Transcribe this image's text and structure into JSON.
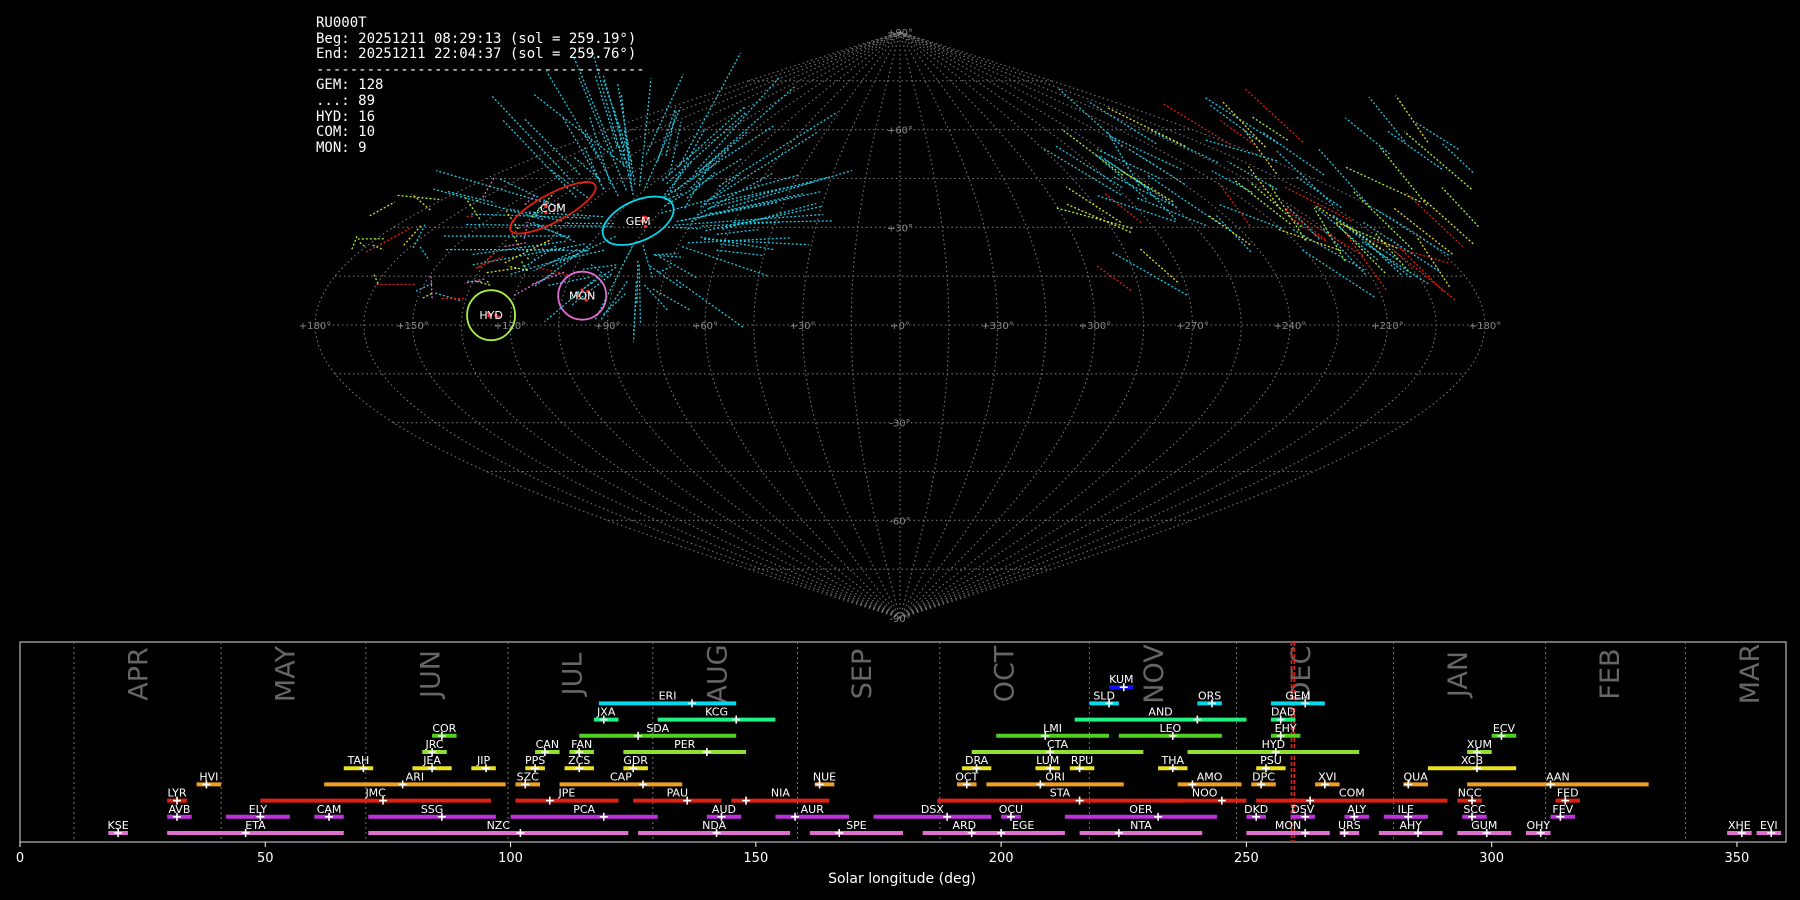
{
  "info": {
    "station": "RU000T",
    "beg": "Beg: 20251211 08:29:13 (sol = 259.19°)",
    "end": "End: 20251211 22:04:37 (sol = 259.76°)",
    "separator": "---------------------------------------",
    "counts": [
      "GEM: 128",
      "...: 89",
      "HYD: 16",
      "COM: 10",
      "MON: 9"
    ]
  },
  "sky_map": {
    "lon_labels": [
      "+180°",
      "+150°",
      "+120°",
      "+90°",
      "+60°",
      "+30°",
      "+0°",
      "+330°",
      "+300°",
      "+270°",
      "+240°",
      "+210°",
      "+180°"
    ],
    "lat_labels": [
      "+90°",
      "+60°",
      "+30°",
      "-30°",
      "-60°",
      "-90°"
    ],
    "radiants": [
      {
        "code": "COM",
        "lon": 132,
        "lat": 36,
        "color": "#e02010"
      },
      {
        "code": "GEM",
        "lon": 95,
        "lat": 32,
        "color": "#00d8ec"
      },
      {
        "code": "MON",
        "lon": 99,
        "lat": 9,
        "color": "#e070d0"
      },
      {
        "code": "HYD",
        "lon": 126,
        "lat": 3,
        "color": "#a8f040"
      }
    ]
  },
  "chart_data": {
    "type": "bar",
    "xlabel": "Solar longitude (deg)",
    "xlim": [
      0,
      360
    ],
    "x_ticks": [
      0,
      50,
      100,
      150,
      200,
      250,
      300,
      350
    ],
    "months": [
      {
        "name": "APR",
        "start": 11
      },
      {
        "name": "MAY",
        "start": 41
      },
      {
        "name": "JUN",
        "start": 70.5
      },
      {
        "name": "JUL",
        "start": 99.5
      },
      {
        "name": "AUG",
        "start": 129
      },
      {
        "name": "SEP",
        "start": 158.5
      },
      {
        "name": "OCT",
        "start": 187.5
      },
      {
        "name": "NOV",
        "start": 218
      },
      {
        "name": "DEC",
        "start": 248
      },
      {
        "name": "JAN",
        "start": 280
      },
      {
        "name": "FEB",
        "start": 311
      },
      {
        "name": "MAR",
        "start": 339.5
      }
    ],
    "current_sol": [
      259.19,
      259.76
    ],
    "showers": [
      {
        "code": "KUM",
        "start": 222,
        "end": 227,
        "peak": 225,
        "row": 10,
        "color": "#1010ff"
      },
      {
        "code": "ERI",
        "start": 118,
        "end": 146,
        "peak": 137,
        "row": 9,
        "color": "#00d8ec"
      },
      {
        "code": "SLD",
        "start": 218,
        "end": 224,
        "peak": 222,
        "row": 9,
        "color": "#00d8ec"
      },
      {
        "code": "ORS",
        "start": 240,
        "end": 245,
        "peak": 243,
        "row": 9,
        "color": "#00d8ec"
      },
      {
        "code": "GEM",
        "start": 255,
        "end": 266,
        "peak": 262,
        "row": 9,
        "color": "#00d8ec"
      },
      {
        "code": "JXA",
        "start": 117,
        "end": 122,
        "peak": 119,
        "row": 8,
        "color": "#20f080"
      },
      {
        "code": "KCG",
        "start": 130,
        "end": 154,
        "peak": 146,
        "row": 8,
        "color": "#20f080"
      },
      {
        "code": "AND",
        "start": 215,
        "end": 250,
        "peak": 240,
        "row": 8,
        "color": "#20f080"
      },
      {
        "code": "DAD",
        "start": 255,
        "end": 260,
        "peak": 257,
        "row": 8,
        "color": "#20f080"
      },
      {
        "code": "COR",
        "start": 84,
        "end": 89,
        "peak": 86,
        "row": 7,
        "color": "#50d020"
      },
      {
        "code": "SDA",
        "start": 114,
        "end": 146,
        "peak": 126,
        "row": 7,
        "color": "#50d020"
      },
      {
        "code": "LMI",
        "start": 199,
        "end": 222,
        "peak": 209,
        "row": 7,
        "color": "#50d020"
      },
      {
        "code": "LEO",
        "start": 224,
        "end": 245,
        "peak": 235,
        "row": 7,
        "color": "#50d020"
      },
      {
        "code": "EHY",
        "start": 255,
        "end": 261,
        "peak": 257,
        "row": 7,
        "color": "#50d020"
      },
      {
        "code": "ECV",
        "start": 300,
        "end": 305,
        "peak": 302,
        "row": 7,
        "color": "#50d020"
      },
      {
        "code": "JRC",
        "start": 82,
        "end": 87,
        "peak": 84,
        "row": 6,
        "color": "#90e030"
      },
      {
        "code": "CAN",
        "start": 105,
        "end": 110,
        "peak": 107,
        "row": 6,
        "color": "#90e030"
      },
      {
        "code": "FAN",
        "start": 112,
        "end": 117,
        "peak": 114,
        "row": 6,
        "color": "#90e030"
      },
      {
        "code": "PER",
        "start": 123,
        "end": 148,
        "peak": 140,
        "row": 6,
        "color": "#90e030"
      },
      {
        "code": "CTA",
        "start": 194,
        "end": 229,
        "peak": 210,
        "row": 6,
        "color": "#90e030"
      },
      {
        "code": "HYD",
        "start": 238,
        "end": 273,
        "peak": 256,
        "row": 6,
        "color": "#90e030"
      },
      {
        "code": "XUM",
        "start": 295,
        "end": 300,
        "peak": 297,
        "row": 6,
        "color": "#90e030"
      },
      {
        "code": "TAH",
        "start": 66,
        "end": 72,
        "peak": 70,
        "row": 5,
        "color": "#e8e020"
      },
      {
        "code": "JEA",
        "start": 80,
        "end": 88,
        "peak": 84,
        "row": 5,
        "color": "#e8e020"
      },
      {
        "code": "JIP",
        "start": 92,
        "end": 97,
        "peak": 95,
        "row": 5,
        "color": "#e8e020"
      },
      {
        "code": "PPS",
        "start": 103,
        "end": 107,
        "peak": 105,
        "row": 5,
        "color": "#e8e020"
      },
      {
        "code": "ZCS",
        "start": 111,
        "end": 117,
        "peak": 114,
        "row": 5,
        "color": "#e8e020"
      },
      {
        "code": "GDR",
        "start": 123,
        "end": 128,
        "peak": 125,
        "row": 5,
        "color": "#e8e020"
      },
      {
        "code": "DRA",
        "start": 192,
        "end": 198,
        "peak": 195,
        "row": 5,
        "color": "#e8e020"
      },
      {
        "code": "LUM",
        "start": 207,
        "end": 212,
        "peak": 210,
        "row": 5,
        "color": "#e8e020"
      },
      {
        "code": "RPU",
        "start": 214,
        "end": 219,
        "peak": 216,
        "row": 5,
        "color": "#e8e020"
      },
      {
        "code": "THA",
        "start": 232,
        "end": 238,
        "peak": 235,
        "row": 5,
        "color": "#e8e020"
      },
      {
        "code": "PSU",
        "start": 252,
        "end": 258,
        "peak": 254,
        "row": 5,
        "color": "#e8e020"
      },
      {
        "code": "XCB",
        "start": 287,
        "end": 305,
        "peak": 297,
        "row": 5,
        "color": "#e8e020"
      },
      {
        "code": "HVI",
        "start": 36,
        "end": 41,
        "peak": 38,
        "row": 4,
        "color": "#f0a020"
      },
      {
        "code": "ARI",
        "start": 62,
        "end": 99,
        "peak": 78,
        "row": 4,
        "color": "#f0a020"
      },
      {
        "code": "SZC",
        "start": 101,
        "end": 106,
        "peak": 103,
        "row": 4,
        "color": "#f0a020"
      },
      {
        "code": "CAP",
        "start": 110,
        "end": 135,
        "peak": 127,
        "row": 4,
        "color": "#f0a020"
      },
      {
        "code": "NUE",
        "start": 162,
        "end": 166,
        "peak": 163,
        "row": 4,
        "color": "#f0a020"
      },
      {
        "code": "OCT",
        "start": 191,
        "end": 195,
        "peak": 193,
        "row": 4,
        "color": "#f0a020"
      },
      {
        "code": "ORI",
        "start": 197,
        "end": 225,
        "peak": 208,
        "row": 4,
        "color": "#f0a020"
      },
      {
        "code": "AMO",
        "start": 236,
        "end": 249,
        "peak": 239,
        "row": 4,
        "color": "#f0a020"
      },
      {
        "code": "DPC",
        "start": 251,
        "end": 256,
        "peak": 253,
        "row": 4,
        "color": "#f0a020"
      },
      {
        "code": "XVI",
        "start": 264,
        "end": 269,
        "peak": 266,
        "row": 4,
        "color": "#f0a020"
      },
      {
        "code": "QUA",
        "start": 282,
        "end": 287,
        "peak": 283,
        "row": 4,
        "color": "#f0a020"
      },
      {
        "code": "AAN",
        "start": 295,
        "end": 332,
        "peak": 312,
        "row": 4,
        "color": "#f0a020"
      },
      {
        "code": "LYR",
        "start": 30,
        "end": 34,
        "peak": 32,
        "row": 3,
        "color": "#e02010"
      },
      {
        "code": "JMC",
        "start": 49,
        "end": 96,
        "peak": 74,
        "row": 3,
        "color": "#e02010"
      },
      {
        "code": "JPE",
        "start": 101,
        "end": 122,
        "peak": 108,
        "row": 3,
        "color": "#e02010"
      },
      {
        "code": "PAU",
        "start": 125,
        "end": 143,
        "peak": 136,
        "row": 3,
        "color": "#e02010"
      },
      {
        "code": "NIA",
        "start": 145,
        "end": 165,
        "peak": 148,
        "row": 3,
        "color": "#e02010"
      },
      {
        "code": "STA",
        "start": 187,
        "end": 237,
        "peak": 216,
        "row": 3,
        "color": "#e02010"
      },
      {
        "code": "NOO",
        "start": 233,
        "end": 250,
        "peak": 245,
        "row": 3,
        "color": "#e02010"
      },
      {
        "code": "COM",
        "start": 252,
        "end": 291,
        "peak": 263,
        "row": 3,
        "color": "#e02010"
      },
      {
        "code": "NCC",
        "start": 293,
        "end": 298,
        "peak": 296,
        "row": 3,
        "color": "#e02010"
      },
      {
        "code": "FED",
        "start": 313,
        "end": 318,
        "peak": 315,
        "row": 3,
        "color": "#e02010"
      },
      {
        "code": "AVB",
        "start": 30,
        "end": 35,
        "peak": 32,
        "row": 2,
        "color": "#c030e0"
      },
      {
        "code": "ELY",
        "start": 42,
        "end": 55,
        "peak": 49,
        "row": 2,
        "color": "#c030e0"
      },
      {
        "code": "CAM",
        "start": 60,
        "end": 66,
        "peak": 63,
        "row": 2,
        "color": "#c030e0"
      },
      {
        "code": "SSG",
        "start": 71,
        "end": 97,
        "peak": 86,
        "row": 2,
        "color": "#c030e0"
      },
      {
        "code": "PCA",
        "start": 100,
        "end": 130,
        "peak": 119,
        "row": 2,
        "color": "#c030e0"
      },
      {
        "code": "AUD",
        "start": 140,
        "end": 147,
        "peak": 143,
        "row": 2,
        "color": "#c030e0"
      },
      {
        "code": "AUR",
        "start": 154,
        "end": 169,
        "peak": 158,
        "row": 2,
        "color": "#c030e0"
      },
      {
        "code": "DSX",
        "start": 174,
        "end": 198,
        "peak": 189,
        "row": 2,
        "color": "#c030e0"
      },
      {
        "code": "OCU",
        "start": 200,
        "end": 204,
        "peak": 202,
        "row": 2,
        "color": "#c030e0"
      },
      {
        "code": "OER",
        "start": 213,
        "end": 244,
        "peak": 232,
        "row": 2,
        "color": "#c030e0"
      },
      {
        "code": "DKD",
        "start": 250,
        "end": 254,
        "peak": 252,
        "row": 2,
        "color": "#c030e0"
      },
      {
        "code": "DSV",
        "start": 259,
        "end": 264,
        "peak": 262,
        "row": 2,
        "color": "#c030e0"
      },
      {
        "code": "ALY",
        "start": 270,
        "end": 275,
        "peak": 272,
        "row": 2,
        "color": "#c030e0"
      },
      {
        "code": "ILE",
        "start": 278,
        "end": 287,
        "peak": 283,
        "row": 2,
        "color": "#c030e0"
      },
      {
        "code": "SCC",
        "start": 294,
        "end": 299,
        "peak": 296,
        "row": 2,
        "color": "#c030e0"
      },
      {
        "code": "FEV",
        "start": 312,
        "end": 317,
        "peak": 314,
        "row": 2,
        "color": "#c030e0"
      },
      {
        "code": "KSE",
        "start": 18,
        "end": 22,
        "peak": 20,
        "row": 1,
        "color": "#e070d0"
      },
      {
        "code": "ETA",
        "start": 30,
        "end": 66,
        "peak": 46,
        "row": 1,
        "color": "#e070d0"
      },
      {
        "code": "NZC",
        "start": 71,
        "end": 124,
        "peak": 102,
        "row": 1,
        "color": "#e070d0"
      },
      {
        "code": "NDA",
        "start": 126,
        "end": 157,
        "peak": 142,
        "row": 1,
        "color": "#e070d0"
      },
      {
        "code": "SPE",
        "start": 161,
        "end": 180,
        "peak": 167,
        "row": 1,
        "color": "#e070d0"
      },
      {
        "code": "ARD",
        "start": 184,
        "end": 201,
        "peak": 194,
        "row": 1,
        "color": "#e070d0"
      },
      {
        "code": "EGE",
        "start": 196,
        "end": 213,
        "peak": 200,
        "row": 1,
        "color": "#e070d0"
      },
      {
        "code": "NTA",
        "start": 216,
        "end": 241,
        "peak": 224,
        "row": 1,
        "color": "#e070d0"
      },
      {
        "code": "MON",
        "start": 250,
        "end": 267,
        "peak": 262,
        "row": 1,
        "color": "#e070d0"
      },
      {
        "code": "URS",
        "start": 269,
        "end": 273,
        "peak": 270,
        "row": 1,
        "color": "#e070d0"
      },
      {
        "code": "AHY",
        "start": 277,
        "end": 290,
        "peak": 285,
        "row": 1,
        "color": "#e070d0"
      },
      {
        "code": "GUM",
        "start": 293,
        "end": 304,
        "peak": 299,
        "row": 1,
        "color": "#e070d0"
      },
      {
        "code": "OHY",
        "start": 307,
        "end": 312,
        "peak": 310,
        "row": 1,
        "color": "#e070d0"
      },
      {
        "code": "XHE",
        "start": 348,
        "end": 353,
        "peak": 351,
        "row": 1,
        "color": "#e070d0"
      },
      {
        "code": "EVI",
        "start": 354,
        "end": 359,
        "peak": 357,
        "row": 1,
        "color": "#e070d0"
      }
    ]
  }
}
